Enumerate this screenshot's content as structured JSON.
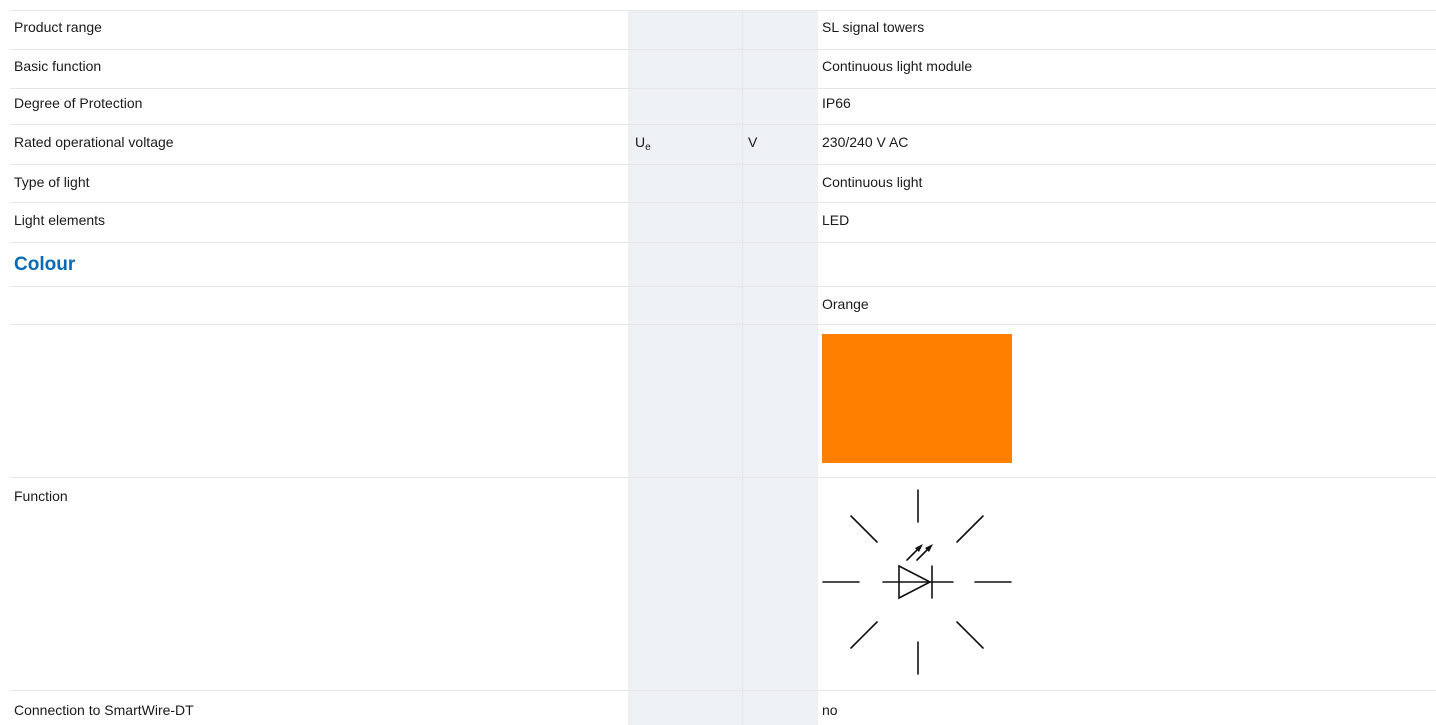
{
  "heading": "Colour",
  "rows": [
    {
      "label": "Product range",
      "value": "SL signal towers"
    },
    {
      "label": "Basic function",
      "value": "Continuous light module"
    },
    {
      "label": "Degree of Protection",
      "value": "IP66"
    },
    {
      "label": "Rated operational voltage",
      "symbol": "U",
      "symbol_sub": "e",
      "unit": "V",
      "value": "230/240 V AC"
    },
    {
      "label": "Type of light",
      "value": "Continuous light"
    },
    {
      "label": "Light elements",
      "value": "LED"
    }
  ],
  "colour": {
    "name": "Orange",
    "swatch_hex": "#ff7f00"
  },
  "function": {
    "label": "Function",
    "icon": "flashing-led-symbol-icon"
  },
  "smartwire": {
    "label": "Connection to SmartWire-DT",
    "value": "no"
  },
  "colors": {
    "accent": "#0a6ab4",
    "shaded_column": "#eef1f4"
  }
}
